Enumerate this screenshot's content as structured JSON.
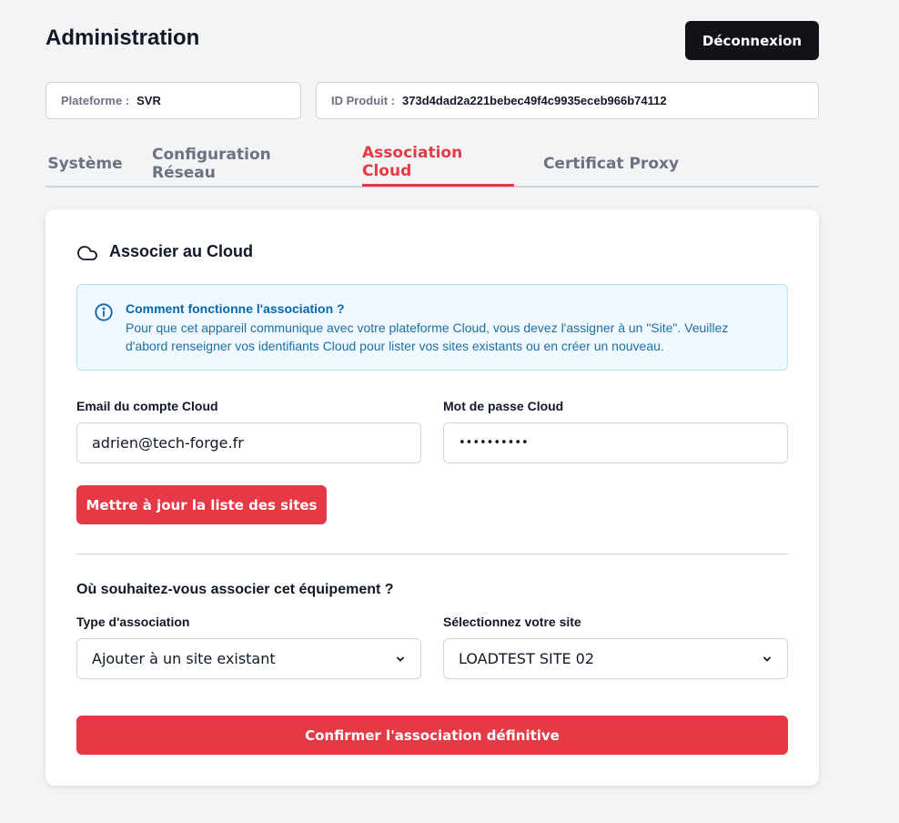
{
  "header": {
    "title": "Administration",
    "logout_label": "Déconnexion"
  },
  "info": {
    "platform_label": "Plateforme :",
    "platform_value": "SVR",
    "product_label": "ID Produit :",
    "product_value": "373d4dad2a221bebec49f4c9935eceb966b74112"
  },
  "tabs": [
    {
      "label": "Système",
      "active": false
    },
    {
      "label": "Configuration Réseau",
      "active": false
    },
    {
      "label": "Association Cloud",
      "active": true
    },
    {
      "label": "Certificat Proxy",
      "active": false
    }
  ],
  "card": {
    "icon": "cloud-icon",
    "title": "Associer au Cloud",
    "alert": {
      "icon": "info-icon",
      "title": "Comment fonctionne l'association ?",
      "text": "Pour que cet appareil communique avec votre plateforme Cloud, vous devez l'assigner à un \"Site\". Veuillez d'abord renseigner vos identifiants Cloud pour lister vos sites existants ou en créer un nouveau."
    },
    "email_label": "Email du compte Cloud",
    "email_value": "adrien@tech-forge.fr",
    "password_label": "Mot de passe Cloud",
    "password_value": "••••••••••",
    "update_button": "Mettre à jour la liste des sites",
    "section_title": "Où souhaitez-vous associer cet équipement ?",
    "type_label": "Type d'association",
    "type_value": "Ajouter à un site existant",
    "site_label": "Sélectionnez votre site",
    "site_value": "LOADTEST SITE 02",
    "confirm_button": "Confirmer l'association définitive"
  },
  "colors": {
    "accent": "#e63946",
    "dark_button": "#111318",
    "info_bg": "#f0f9ff",
    "info_text": "#0b67a6"
  }
}
